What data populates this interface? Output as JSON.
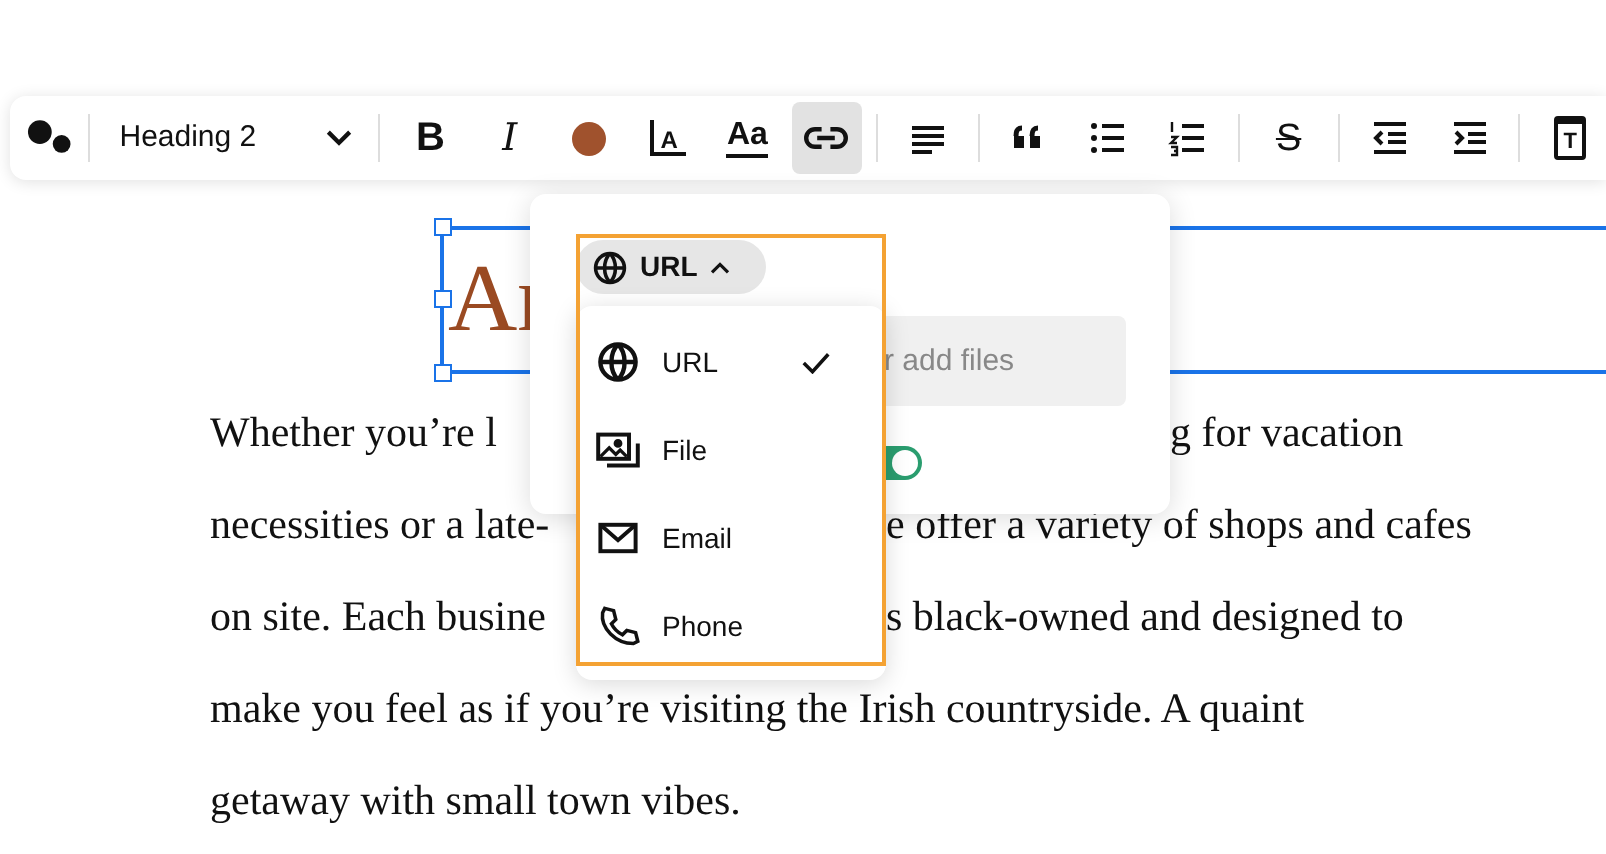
{
  "toolbar": {
    "style_select": {
      "value": "Heading 2"
    },
    "buttons": [
      {
        "kind": "bold",
        "glyph": "B",
        "selected": false
      },
      {
        "kind": "italic",
        "glyph": "I",
        "selected": false
      },
      {
        "kind": "color",
        "color": "#a0522d",
        "selected": false
      },
      {
        "kind": "size",
        "glyph": "A",
        "selected": false
      },
      {
        "kind": "font",
        "glyph": "Aa",
        "selected": false
      },
      {
        "kind": "link",
        "selected": true
      },
      {
        "kind": "divider"
      },
      {
        "kind": "align",
        "selected": false
      },
      {
        "kind": "divider"
      },
      {
        "kind": "quote",
        "selected": false
      },
      {
        "kind": "bullets",
        "selected": false
      },
      {
        "kind": "numbers",
        "selected": false
      },
      {
        "kind": "divider"
      },
      {
        "kind": "strike",
        "glyph": "S",
        "selected": false
      },
      {
        "kind": "divider"
      },
      {
        "kind": "outdent",
        "selected": false
      },
      {
        "kind": "indent",
        "selected": false
      },
      {
        "kind": "divider"
      },
      {
        "kind": "clipboard",
        "glyph": "T",
        "selected": false
      }
    ]
  },
  "heading": {
    "text": "Ar",
    "selected": true
  },
  "paragraph_lines": [
    {
      "left": "Whether you’re l",
      "right": "g for vacation"
    },
    {
      "left": "necessities or a late-",
      "right": "e offer a variety of shops and cafes"
    },
    {
      "left": "on site. Each busine",
      "right": "s black-owned and designed to"
    },
    {
      "left": "make you feel as if you’re visiting the Irish countryside. A quaint"
    },
    {
      "left": "getaway with small town vibes."
    }
  ],
  "link_popover": {
    "type_select": {
      "value": "URL",
      "expanded": true
    },
    "input": {
      "placeholder": "r add files"
    },
    "toggle": {
      "on": true
    }
  },
  "link_type_menu": [
    {
      "kind": "url",
      "label": "URL",
      "selected": true
    },
    {
      "kind": "file",
      "label": "File",
      "selected": false
    },
    {
      "kind": "email",
      "label": "Email",
      "selected": false
    },
    {
      "kind": "phone",
      "label": "Phone",
      "selected": false
    }
  ]
}
